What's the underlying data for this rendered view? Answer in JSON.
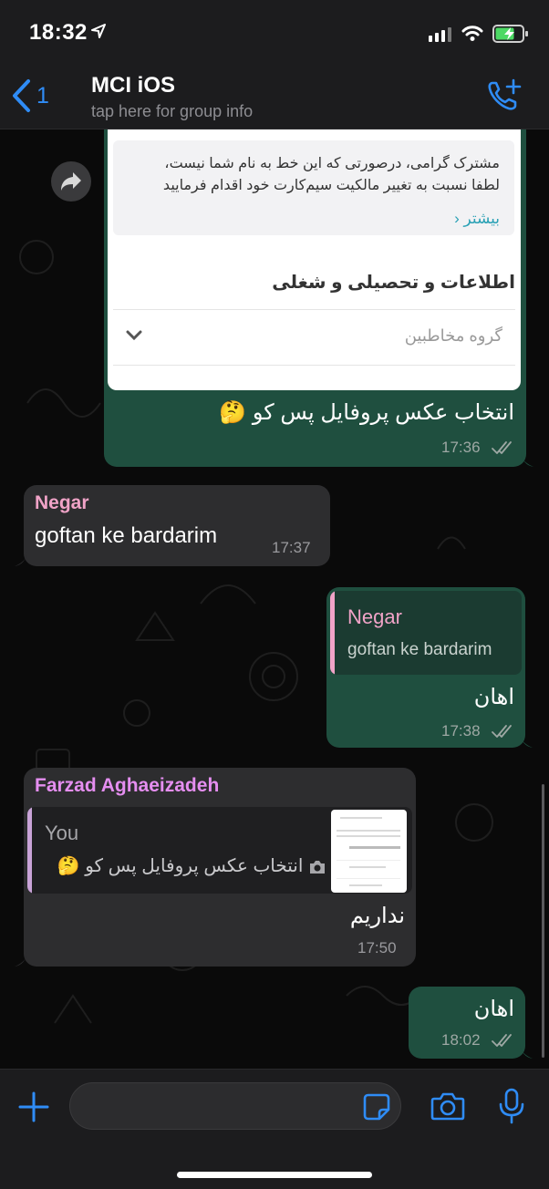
{
  "status_bar": {
    "time": "18:32"
  },
  "header": {
    "back_count": "1",
    "title": "MCI iOS",
    "subtitle": "tap here for group info"
  },
  "messages": [
    {
      "type": "image-out",
      "image": {
        "notice_line1": "مشترک گرامی، درصورتی که این خط به نام شما نیست،",
        "notice_line2": "لطفا نسبت به تغییر مالکیت سیم‌کارت خود اقدام فرمایید",
        "notice_link": "بیشتر",
        "section_title": "اطلاعات و تحصیلی و شغلی",
        "select_value": "گروه مخاطبین"
      },
      "caption": "انتخاب عکس پروفایل پس کو 🤔",
      "time": "17:36"
    },
    {
      "type": "in",
      "sender": "Negar",
      "text": "goftan ke bardarim",
      "time": "17:37"
    },
    {
      "type": "out-reply",
      "quote_sender": "Negar",
      "quote_text": "goftan ke bardarim",
      "text": "اهان",
      "time": "17:38"
    },
    {
      "type": "in-reply",
      "sender": "Farzad Aghaeizadeh",
      "quote_sender": "You",
      "quote_text": "انتخاب عکس پروفایل پس کو 🤔",
      "text": "نداریم",
      "time": "17:50"
    },
    {
      "type": "out",
      "text": "اهان",
      "time": "18:02"
    }
  ],
  "input": {
    "placeholder": ""
  },
  "colors": {
    "accent": "#2f8cf6",
    "outgoing_bubble": "#1f4f3f",
    "incoming_bubble": "#2d2d2f",
    "negar": "#f0a3c7",
    "farzad": "#e58ef0"
  }
}
